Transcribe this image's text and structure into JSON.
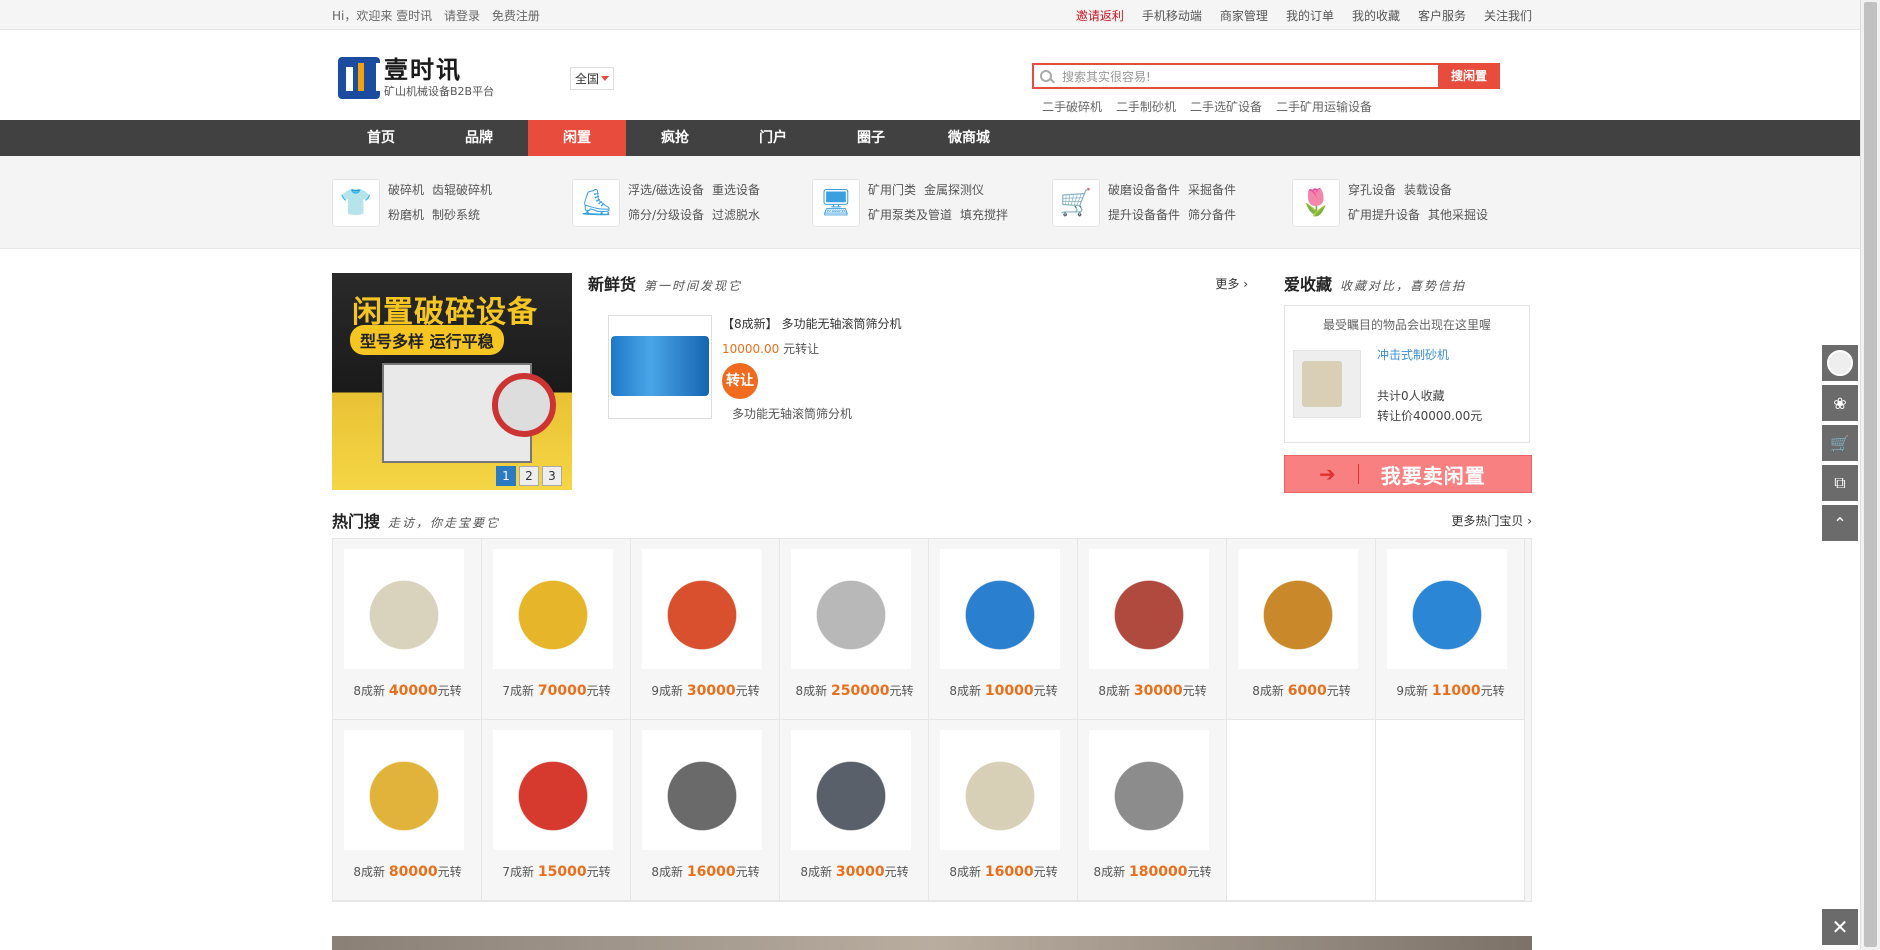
{
  "topbar": {
    "greeting": "Hi，欢迎来 壹时讯",
    "login": "请登录",
    "register": "免费注册",
    "links": [
      {
        "label": "邀请返利",
        "red": true
      },
      {
        "label": "手机移动端"
      },
      {
        "label": "商家管理"
      },
      {
        "label": "我的订单"
      },
      {
        "label": "我的收藏"
      },
      {
        "label": "客户服务"
      },
      {
        "label": "关注我们"
      }
    ]
  },
  "header": {
    "logo_title": "壹时讯",
    "logo_subtitle": "矿山机械设备B2B平台",
    "region": "全国",
    "search_placeholder": "搜索其实很容易!",
    "search_button": "搜闲置",
    "hotwords": [
      "二手破碎机",
      "二手制砂机",
      "二手选矿设备",
      "二手矿用运输设备"
    ]
  },
  "nav": [
    "首页",
    "品牌",
    "闲置",
    "疯抢",
    "门户",
    "圈子",
    "微商城"
  ],
  "categories": [
    {
      "icon": "tshirt-icon",
      "glyph": "👕",
      "links": [
        [
          "破碎机",
          "齿辊破碎机"
        ],
        [
          "粉磨机",
          "制砂系统"
        ]
      ]
    },
    {
      "icon": "skater-icon",
      "glyph": "⛸",
      "links": [
        [
          "浮选/磁选设备",
          "重选设备"
        ],
        [
          "筛分/分级设备",
          "过滤脱水"
        ]
      ]
    },
    {
      "icon": "monitor-icon",
      "glyph": "🖥",
      "links": [
        [
          "矿用门类",
          "金属探测仪"
        ],
        [
          "矿用泵类及管道",
          "填充搅拌"
        ]
      ]
    },
    {
      "icon": "stroller-icon",
      "glyph": "🛒",
      "links": [
        [
          "破磨设备备件",
          "采掘备件"
        ],
        [
          "提升设备备件",
          "筛分备件"
        ]
      ]
    },
    {
      "icon": "tulip-icon",
      "glyph": "🌷",
      "links": [
        [
          "穿孔设备",
          "装载设备"
        ],
        [
          "矿用提升设备",
          "其他采掘设"
        ]
      ]
    }
  ],
  "banner": {
    "headline": "闲置破碎设备",
    "tagline": "型号多样 运行平稳",
    "pages": [
      "1",
      "2",
      "3"
    ],
    "active_page": "1"
  },
  "fresh": {
    "title": "新鲜货",
    "subtitle": "第一时间发现它",
    "more": "更多",
    "item": {
      "name": "【8成新】 多功能无轴滚筒筛分机",
      "price": "10000.00",
      "price_unit": "元转让",
      "badge": "转让",
      "desc": "多功能无轴滚筒筛分机"
    }
  },
  "favorites": {
    "title": "爱收藏",
    "subtitle": "收藏对比，喜势信拍",
    "hint": "最受瞩目的物品会出现在这里喔",
    "link": "冲击式制砂机",
    "count": "共计0人收藏",
    "price": "转让价40000.00元",
    "sell_button": "我要卖闲置"
  },
  "hot": {
    "title": "热门搜",
    "subtitle": "走访，你走宝要它",
    "more": "更多热门宝贝",
    "items": [
      {
        "cond": "8成新",
        "price": "40000",
        "unit": "元转",
        "color": "#d9d2bd"
      },
      {
        "cond": "7成新",
        "price": "70000",
        "unit": "元转",
        "color": "#e7b52a"
      },
      {
        "cond": "9成新",
        "price": "30000",
        "unit": "元转",
        "color": "#d9502e"
      },
      {
        "cond": "8成新",
        "price": "250000",
        "unit": "元转",
        "color": "#b8b8b8"
      },
      {
        "cond": "8成新",
        "price": "10000",
        "unit": "元转",
        "color": "#2a7fcf"
      },
      {
        "cond": "8成新",
        "price": "30000",
        "unit": "元转",
        "color": "#b14a3e"
      },
      {
        "cond": "8成新",
        "price": "6000",
        "unit": "元转",
        "color": "#c9892b"
      },
      {
        "cond": "9成新",
        "price": "11000",
        "unit": "元转",
        "color": "#2b86d6"
      },
      {
        "cond": "8成新",
        "price": "80000",
        "unit": "元转",
        "color": "#e2b33a"
      },
      {
        "cond": "7成新",
        "price": "15000",
        "unit": "元转",
        "color": "#d63a2f"
      },
      {
        "cond": "8成新",
        "price": "16000",
        "unit": "元转",
        "color": "#6a6a6a"
      },
      {
        "cond": "8成新",
        "price": "30000",
        "unit": "元转",
        "color": "#59606a"
      },
      {
        "cond": "8成新",
        "price": "16000",
        "unit": "元转",
        "color": "#d8d0b6"
      },
      {
        "cond": "8成新",
        "price": "180000",
        "unit": "元转",
        "color": "#8c8c8c"
      }
    ]
  },
  "sidebar": [
    "avatar-icon",
    "gift-icon",
    "cart-icon",
    "coupon-icon",
    "back-to-top-icon"
  ],
  "close_glyph": "✕"
}
